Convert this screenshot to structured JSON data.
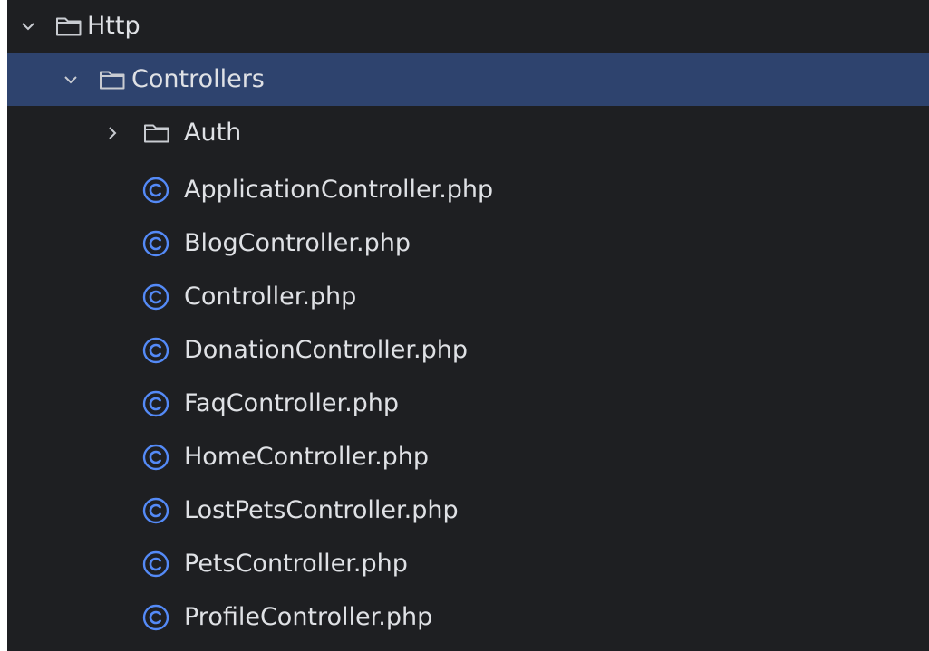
{
  "tree": {
    "http": {
      "label": "Http",
      "icon": "folder-icon",
      "expanded": true
    },
    "controllers": {
      "label": "Controllers",
      "icon": "folder-icon",
      "expanded": true,
      "selected": true
    },
    "auth": {
      "label": "Auth",
      "icon": "folder-icon",
      "expanded": false
    },
    "files": [
      {
        "label": "ApplicationController.php",
        "icon": "class-icon"
      },
      {
        "label": "BlogController.php",
        "icon": "class-icon"
      },
      {
        "label": "Controller.php",
        "icon": "class-icon"
      },
      {
        "label": "DonationController.php",
        "icon": "class-icon"
      },
      {
        "label": "FaqController.php",
        "icon": "class-icon"
      },
      {
        "label": "HomeController.php",
        "icon": "class-icon"
      },
      {
        "label": "LostPetsController.php",
        "icon": "class-icon"
      },
      {
        "label": "PetsController.php",
        "icon": "class-icon"
      },
      {
        "label": "ProfileController.php",
        "icon": "class-icon"
      }
    ]
  },
  "colors": {
    "background": "#1e1f22",
    "selection": "#2e436e",
    "text": "#dfe1e5",
    "class_icon": "#548af7"
  }
}
